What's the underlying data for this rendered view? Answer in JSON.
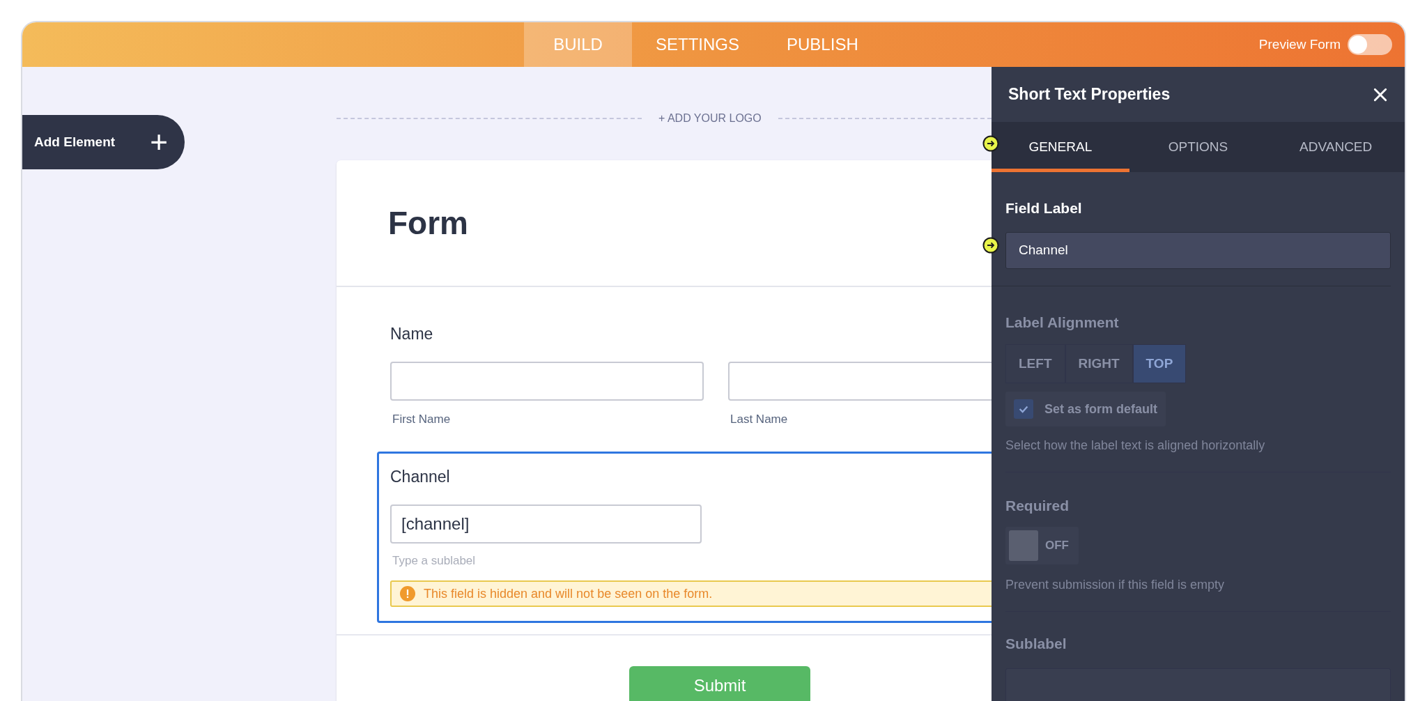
{
  "topbar": {
    "tabs": [
      {
        "label": "BUILD",
        "selected": true
      },
      {
        "label": "SETTINGS",
        "selected": false
      },
      {
        "label": "PUBLISH",
        "selected": false
      }
    ],
    "preview": {
      "label": "Preview Form",
      "on": false
    }
  },
  "add_element": {
    "label": "Add Element",
    "icon": "+"
  },
  "logo_prompt": "+ ADD YOUR LOGO",
  "form": {
    "title": "Form",
    "fields": [
      {
        "kind": "fullname",
        "label": "Name",
        "selected": false,
        "sublabels": [
          "First Name",
          "Last Name"
        ]
      },
      {
        "kind": "short_text",
        "label": "Channel",
        "selected": true,
        "value": "[channel]",
        "sublabel_placeholder": "Type a sublabel",
        "warning": "This field is hidden and will not be seen on the form."
      }
    ],
    "submit": "Submit"
  },
  "panel": {
    "title": "Short Text Properties",
    "tabs": [
      {
        "label": "GENERAL",
        "selected": true
      },
      {
        "label": "OPTIONS",
        "selected": false
      },
      {
        "label": "ADVANCED",
        "selected": false
      }
    ],
    "field_label": {
      "title": "Field Label",
      "value": "Channel"
    },
    "dimmed": true,
    "label_alignment": {
      "title": "Label Alignment",
      "options": [
        {
          "label": "LEFT",
          "selected": false
        },
        {
          "label": "RIGHT",
          "selected": false
        },
        {
          "label": "TOP",
          "selected": true
        }
      ],
      "default": {
        "label": "Set as form default",
        "checked": true
      },
      "hint": "Select how the label text is aligned horizontally"
    },
    "required": {
      "title": "Required",
      "on": false,
      "state_label": "OFF",
      "hint": "Prevent submission if this field is empty"
    },
    "sublabel": {
      "title": "Sublabel"
    }
  }
}
